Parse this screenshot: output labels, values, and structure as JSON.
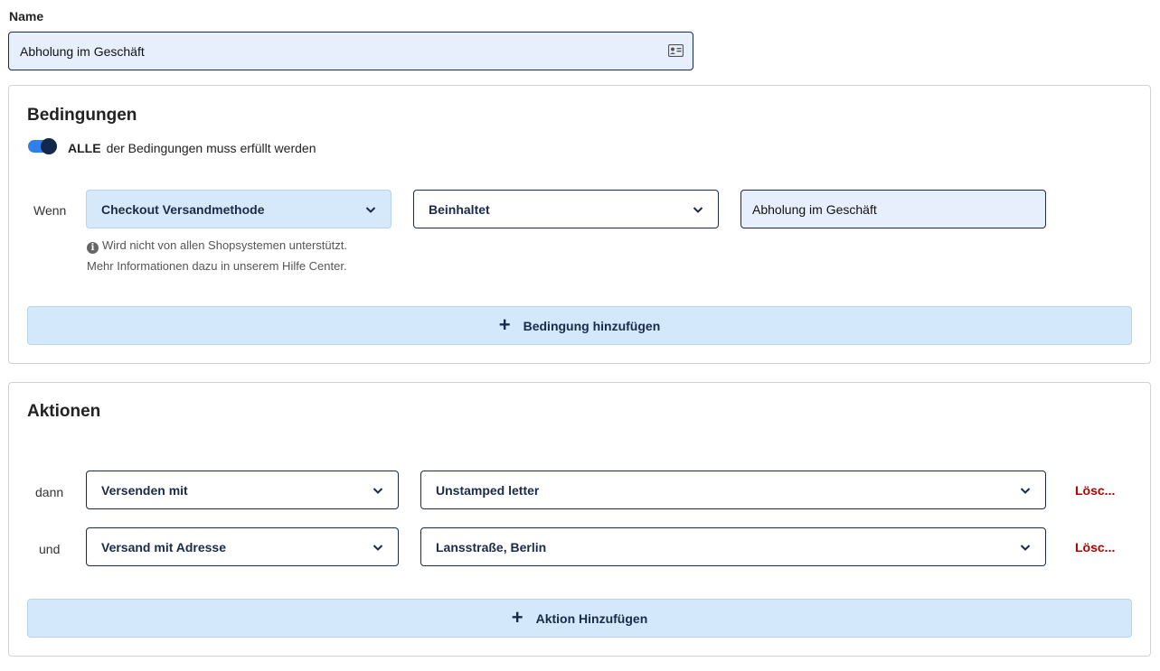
{
  "name": {
    "label": "Name",
    "value": "Abholung im Geschäft",
    "icon": "contact-card-icon"
  },
  "conditions": {
    "title": "Bedingungen",
    "toggle": {
      "on": true,
      "strong": "ALLE",
      "text": "der Bedingungen muss erfüllt werden"
    },
    "row": {
      "label": "Wenn",
      "field": "Checkout Versandmethode",
      "operator": "Beinhaltet",
      "value": "Abholung im Geschäft"
    },
    "hint_line1": "Wird nicht von allen Shopsystemen unterstützt.",
    "hint_line2": "Mehr Informationen dazu in unserem Hilfe Center.",
    "add_label": "Bedingung hinzufügen"
  },
  "actions": {
    "title": "Aktionen",
    "rows": [
      {
        "label": "dann",
        "action": "Versenden mit",
        "value": "Unstamped letter",
        "delete": "Lösc..."
      },
      {
        "label": "und",
        "action": "Versand mit Adresse",
        "value": "Lansstraße, Berlin",
        "delete": "Lösc..."
      }
    ],
    "add_label": "Aktion Hinzufügen"
  },
  "colors": {
    "accent": "#2f80ed",
    "navy": "#1a2a4a",
    "button_bg": "#d3e8fb",
    "danger": "#b30000"
  }
}
